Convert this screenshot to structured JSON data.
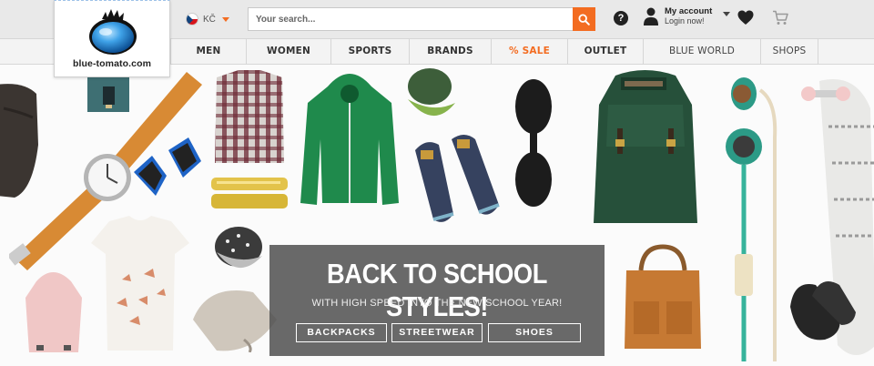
{
  "brand": {
    "logo_text": "blue-tomato.com"
  },
  "header": {
    "language": "KČ",
    "search_placeholder": "Your search...",
    "help_label": "?",
    "account_title": "My account",
    "account_subtitle": "Login now!"
  },
  "nav": {
    "items": [
      {
        "label": "MEN"
      },
      {
        "label": "WOMEN"
      },
      {
        "label": "SPORTS"
      },
      {
        "label": "BRANDS"
      },
      {
        "label": "% SALE"
      },
      {
        "label": "OUTLET"
      },
      {
        "label": "BLUE WORLD"
      },
      {
        "label": "SHOPS"
      }
    ]
  },
  "promo": {
    "title": "BACK TO SCHOOL STYLES!",
    "subtitle": "WITH HIGH SPEED INTO THE NEW SCHOOL YEAR!",
    "buttons": [
      {
        "label": "BACKPACKS"
      },
      {
        "label": "STREETWEAR"
      },
      {
        "label": "SHOES"
      }
    ]
  },
  "colors": {
    "accent": "#f36c21",
    "topbar": "#e9e9e9",
    "nav": "#f3f3f3",
    "promo_overlay": "#505050"
  },
  "icons": [
    "czech-flag-icon",
    "search-icon",
    "help-icon",
    "user-icon",
    "heart-icon",
    "cart-icon"
  ]
}
